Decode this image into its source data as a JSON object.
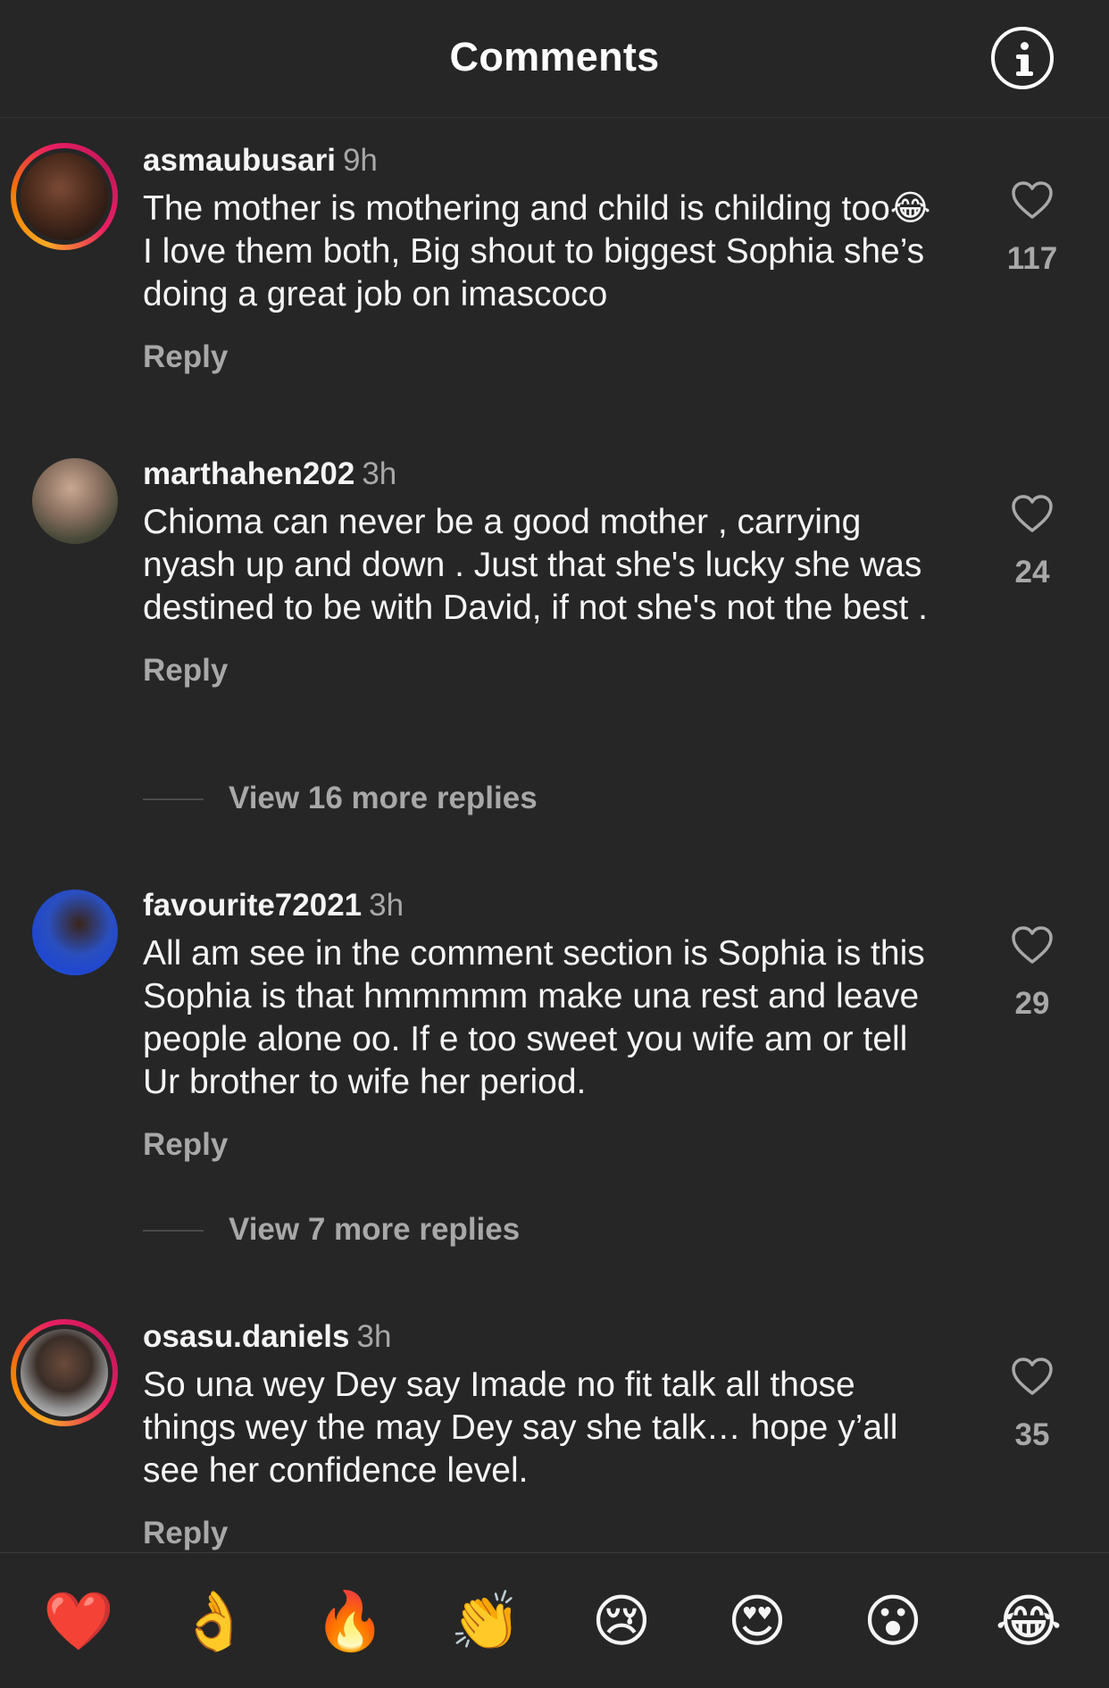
{
  "header": {
    "title": "Comments"
  },
  "comments": [
    {
      "username": "asmaubusari",
      "time": "9h",
      "text": "The mother is mothering and child is childing too😂 I love them both, Big shout to biggest Sophia she’s doing a great job on imascoco",
      "reply_label": "Reply",
      "likes": "117",
      "story_ring": true
    },
    {
      "username": "marthahen202",
      "time": "3h",
      "text": "Chioma can never be a good mother , carrying nyash up and down . Just that she's lucky she was destined to be with David, if not she's not the best .",
      "reply_label": "Reply",
      "likes": "24",
      "view_more": "View 16 more replies",
      "story_ring": false
    },
    {
      "username": "favourite72021",
      "time": "3h",
      "text": "All am see in the comment section is Sophia is this Sophia is that hmmmmm make una rest and leave people alone oo.  If e too sweet you wife am or tell Ur brother to wife her period.",
      "reply_label": "Reply",
      "likes": "29",
      "view_more": "View 7 more replies",
      "story_ring": false
    },
    {
      "username": "osasu.daniels",
      "time": "3h",
      "text": "So una wey Dey say Imade no fit talk all those things wey the may Dey say she talk… hope y’all see her confidence level.",
      "reply_label": "Reply",
      "likes": "35",
      "story_ring": true
    }
  ],
  "reactions": [
    "❤️",
    "👌",
    "🔥",
    "👏",
    "😢",
    "😍",
    "😮",
    "😂"
  ],
  "colors": {
    "background": "#262626",
    "secondary_text": "#a8a8a8",
    "story_ring_start": "#f9a825",
    "story_ring_end": "#e91e63"
  }
}
